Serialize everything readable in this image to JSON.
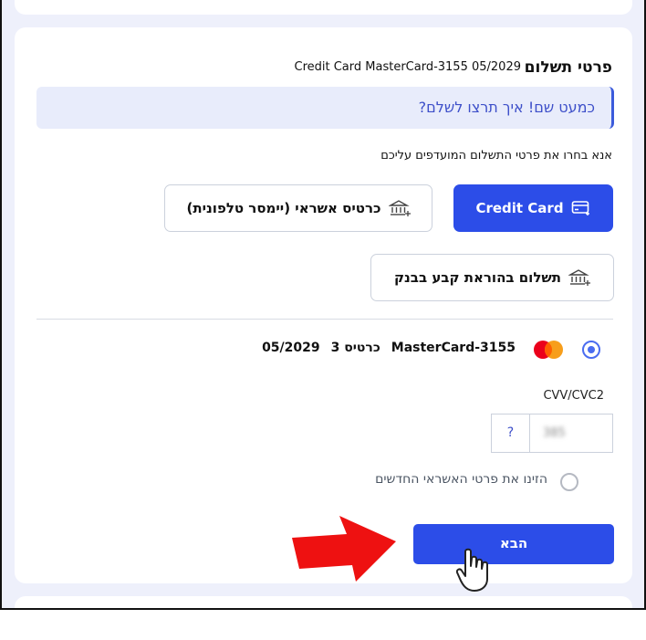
{
  "payment": {
    "title": "פרטי תשלום",
    "summary": "Credit Card MasterCard-3155 05/2029",
    "banner": "כמעט שם! איך תרצו לשלם?",
    "instructions": "אנא בחרו את פרטי התשלום המועדפים עליכם",
    "methods": {
      "credit_card": "Credit Card",
      "phone_card": "כרטיס אשראי (יימסר טלפונית)",
      "bank": "תשלום בהוראת קבע בבנק"
    },
    "saved_card": {
      "name": "MasterCard-3155",
      "label": "כרטיס 3",
      "expiry": "05/2029",
      "selected": true
    },
    "cvv": {
      "label": "CVV/CVC2",
      "value": "385",
      "help": "?"
    },
    "new_card_label": "הזינו את פרטי האשראי החדשים",
    "next_button": "הבא"
  },
  "colors": {
    "primary": "#2c4de8",
    "banner_bg": "#e8ecfb",
    "page_bg": "#eef0fb",
    "annotation_arrow": "#ee1111"
  },
  "icons": [
    "credit-card-icon",
    "bank-icon",
    "mastercard-logo",
    "question-icon",
    "red-arrow",
    "pointer-hand-icon"
  ]
}
